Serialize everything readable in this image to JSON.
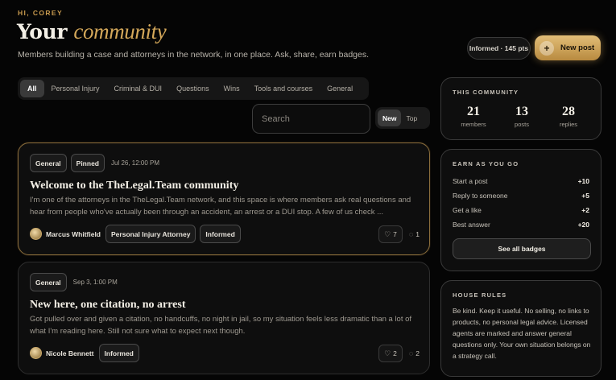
{
  "header": {
    "greeting": "HI, COREY",
    "title_main": "Your",
    "title_accent": "community",
    "subtitle": "Members building a case and attorneys in the network, in one place. Ask, share, earn badges.",
    "points_badge": "Informed · 145 pts",
    "new_post_label": "New post"
  },
  "filters": [
    "All",
    "Personal Injury",
    "Criminal & DUI",
    "Questions",
    "Wins",
    "Tools and courses",
    "General"
  ],
  "active_filter": "All",
  "search": {
    "placeholder": "Search"
  },
  "sort": {
    "new": "New",
    "top": "Top",
    "active": "New"
  },
  "posts": [
    {
      "tags": [
        "General",
        "Pinned"
      ],
      "date": "Jul 26, 12:00 PM",
      "title": "Welcome to the TheLegal.Team community",
      "body": "I'm one of the attorneys in the TheLegal.Team network, and this space is where members ask real questions and hear from people who've actually been through an accident, an arrest or a DUI stop. A few of us check ...",
      "author": "Marcus Whitfield",
      "author_badges": [
        "Personal Injury Attorney",
        "Informed"
      ],
      "likes": "7",
      "replies": "1"
    },
    {
      "tags": [
        "General"
      ],
      "date": "Sep 3, 1:00 PM",
      "title": "New here, one citation, no arrest",
      "body": "Got pulled over and given a citation, no handcuffs, no night in jail, so my situation feels less dramatic than a lot of what I'm reading here. Still not sure what to expect next though.",
      "author": "Nicole Bennett",
      "author_badges": [
        "Informed"
      ],
      "likes": "2",
      "replies": "2"
    }
  ],
  "community": {
    "title": "THIS COMMUNITY",
    "stats": [
      {
        "num": "21",
        "label": "members"
      },
      {
        "num": "13",
        "label": "posts"
      },
      {
        "num": "28",
        "label": "replies"
      }
    ]
  },
  "earn": {
    "title": "EARN AS YOU GO",
    "rows": [
      {
        "label": "Start a post",
        "pts": "+10"
      },
      {
        "label": "Reply to someone",
        "pts": "+5"
      },
      {
        "label": "Get a like",
        "pts": "+2"
      },
      {
        "label": "Best answer",
        "pts": "+20"
      }
    ],
    "button": "See all badges"
  },
  "rules": {
    "title": "HOUSE RULES",
    "text": "Be kind. Keep it useful. No selling, no links to products, no personal legal advice. Licensed agents are marked and answer general questions only. Your own situation belongs on a strategy call."
  },
  "icons": {
    "like": "heart-icon",
    "reply": "comment-icon",
    "plus": "plus-icon"
  },
  "colors": {
    "accent": "#d4a85a",
    "background": "#050505"
  }
}
